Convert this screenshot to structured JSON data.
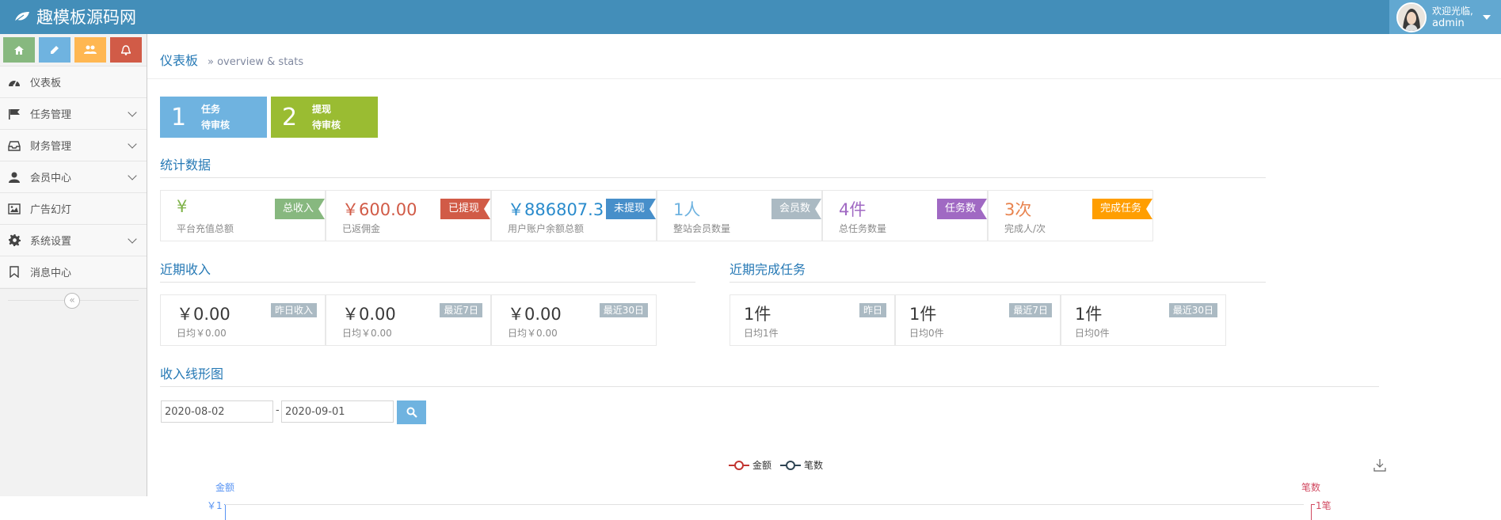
{
  "app": {
    "title": "趣模板源码网"
  },
  "user": {
    "welcome": "欢迎光临,",
    "name": "admin"
  },
  "sidebar": {
    "shortcuts": [
      {
        "icon": "home-icon",
        "color": "#87b87f"
      },
      {
        "icon": "pencil-icon",
        "color": "#6fb3e0"
      },
      {
        "icon": "users-icon",
        "color": "#ffb752"
      },
      {
        "icon": "bell-icon",
        "color": "#d15b47"
      }
    ],
    "items": [
      {
        "label": "仪表板",
        "icon": "dashboard-icon"
      },
      {
        "label": "任务管理",
        "icon": "flag-icon"
      },
      {
        "label": "财务管理",
        "icon": "inbox-icon"
      },
      {
        "label": "会员中心",
        "icon": "user-icon"
      },
      {
        "label": "广告幻灯",
        "icon": "picture-icon"
      },
      {
        "label": "系统设置",
        "icon": "gear-icon"
      },
      {
        "label": "消息中心",
        "icon": "bookmark-icon"
      }
    ],
    "collapse_glyph": "«"
  },
  "page": {
    "title": "仪表板",
    "subtitle": "» overview & stats"
  },
  "tiles": [
    {
      "num": "1",
      "line1": "任务",
      "line2": "待审核"
    },
    {
      "num": "2",
      "line1": "提现",
      "line2": "待审核"
    }
  ],
  "stats": {
    "title": "统计数据",
    "boxes": [
      {
        "value": "¥",
        "desc": "平台充值总额",
        "flag": "总收入"
      },
      {
        "value": "￥600.00",
        "desc": "已返佣金",
        "flag": "已提现"
      },
      {
        "value": "￥886807.3",
        "desc": "用户账户余额总额",
        "flag": "未提现"
      },
      {
        "value": "1人",
        "desc": "整站会员数量",
        "flag": "会员数"
      },
      {
        "value": "4件",
        "desc": "总任务数量",
        "flag": "任务数"
      },
      {
        "value": "3次",
        "desc": "完成人/次",
        "flag": "完成任务"
      }
    ]
  },
  "recent_income": {
    "title": "近期收入",
    "boxes": [
      {
        "value": "￥0.00",
        "desc": "日均￥0.00",
        "badge": "昨日收入"
      },
      {
        "value": "￥0.00",
        "desc": "日均￥0.00",
        "badge": "最近7日"
      },
      {
        "value": "￥0.00",
        "desc": "日均￥0.00",
        "badge": "最近30日"
      }
    ]
  },
  "recent_tasks": {
    "title": "近期完成任务",
    "boxes": [
      {
        "value": "1件",
        "desc": "日均1件",
        "badge": "昨日"
      },
      {
        "value": "1件",
        "desc": "日均0件",
        "badge": "最近7日"
      },
      {
        "value": "1件",
        "desc": "日均0件",
        "badge": "最近30日"
      }
    ]
  },
  "chart_section": {
    "title": "收入线形图",
    "date_from": "2020-08-02",
    "date_sep": "-",
    "date_to": "2020-09-01"
  },
  "chart_data": {
    "type": "line",
    "series": [
      {
        "name": "金额",
        "color": "#c23531"
      },
      {
        "name": "笔数",
        "color": "#2f4554"
      }
    ],
    "y_left": {
      "name": "金额",
      "top_tick": "￥1",
      "color": "#5793f3"
    },
    "y_right": {
      "name": "笔数",
      "top_tick": "1笔",
      "color": "#d14a61"
    }
  }
}
